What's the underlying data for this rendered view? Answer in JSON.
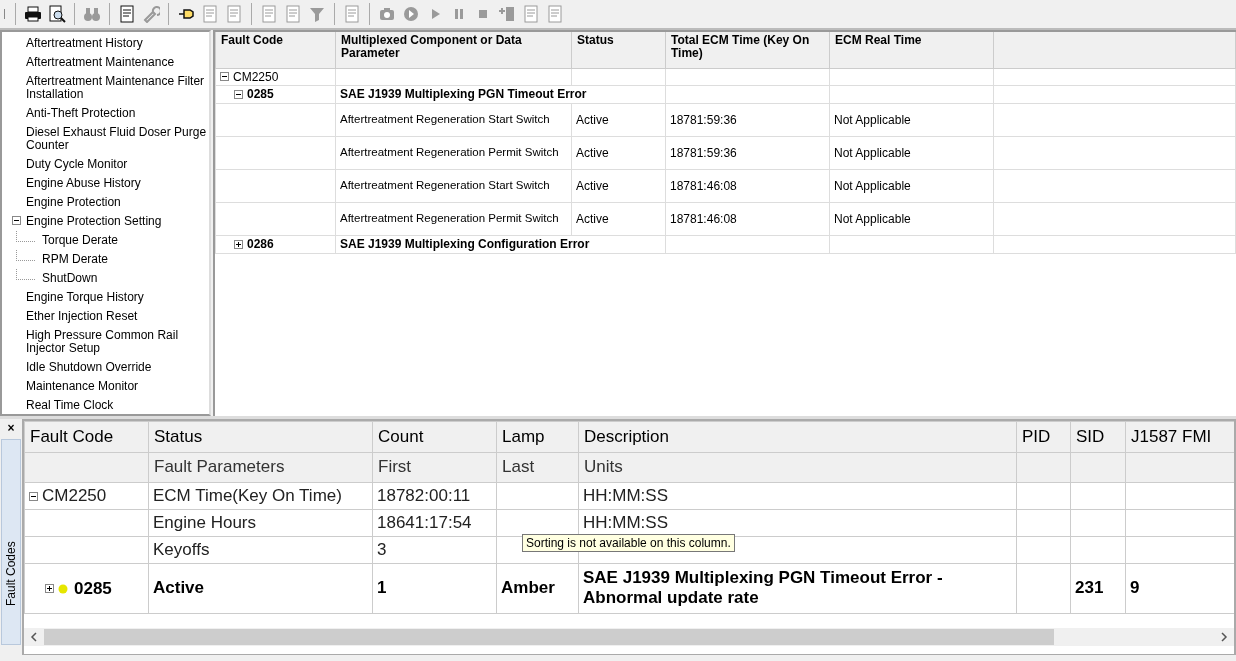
{
  "toolbar": {
    "groups": [
      [
        {
          "disabled": false
        },
        {
          "disabled": false
        }
      ],
      [
        {
          "disabled": true
        }
      ],
      [
        {
          "disabled": false
        },
        {
          "disabled": true
        }
      ],
      [
        {
          "disabled": false
        },
        {
          "disabled": true
        },
        {
          "disabled": true
        }
      ],
      [
        {
          "disabled": true
        },
        {
          "disabled": true
        },
        {
          "disabled": true
        }
      ],
      [
        {
          "disabled": true
        }
      ],
      [
        {
          "disabled": true
        },
        {
          "disabled": true
        },
        {
          "disabled": true
        },
        {
          "disabled": true
        },
        {
          "disabled": true
        },
        {
          "disabled": true
        },
        {
          "disabled": true
        },
        {
          "disabled": true
        }
      ]
    ]
  },
  "sidebar": {
    "items": [
      {
        "label": "Aftertreatment History"
      },
      {
        "label": "Aftertreatment Maintenance"
      },
      {
        "label": "Aftertreatment Maintenance Filter Installation"
      },
      {
        "label": "Anti-Theft Protection"
      },
      {
        "label": "Diesel Exhaust Fluid Doser Purge Counter"
      },
      {
        "label": "Duty Cycle Monitor"
      },
      {
        "label": "Engine Abuse History"
      },
      {
        "label": "Engine Protection"
      },
      {
        "label": "Engine Protection Setting",
        "expanded": true,
        "children": [
          {
            "label": "Torque Derate"
          },
          {
            "label": "RPM Derate"
          },
          {
            "label": "ShutDown"
          }
        ]
      },
      {
        "label": "Engine Torque History"
      },
      {
        "label": "Ether Injection Reset"
      },
      {
        "label": "High Pressure Common Rail Injector Setup"
      },
      {
        "label": "Idle Shutdown Override"
      },
      {
        "label": "Maintenance Monitor"
      },
      {
        "label": "Real Time Clock"
      }
    ]
  },
  "fault_table": {
    "columns": [
      "Fault Code",
      "Multiplexed Component or Data Parameter",
      "Status",
      "Total ECM Time (Key On Time)",
      "ECM Real Time"
    ],
    "rows": [
      {
        "code": "CM2250",
        "expanded": true,
        "children": [
          {
            "code": "0285",
            "title": "SAE J1939 Multiplexing PGN Timeout Error",
            "expanded": true,
            "children": [
              {
                "component": "Aftertreatment Regeneration Start Switch",
                "status": "Active",
                "total_time": "18781:59:36",
                "real_time": "Not Applicable"
              },
              {
                "component": "Aftertreatment Regeneration Permit Switch",
                "status": "Active",
                "total_time": "18781:59:36",
                "real_time": "Not Applicable"
              },
              {
                "component": "Aftertreatment Regeneration Start Switch",
                "status": "Active",
                "total_time": "18781:46:08",
                "real_time": "Not Applicable"
              },
              {
                "component": "Aftertreatment Regeneration Permit Switch",
                "status": "Active",
                "total_time": "18781:46:08",
                "real_time": "Not Applicable"
              }
            ]
          },
          {
            "code": "0286",
            "title": "SAE J1939 Multiplexing Configuration Error",
            "expanded": false
          }
        ]
      }
    ]
  },
  "fault_codes": {
    "close_glyph": "×",
    "tab": "Fault Codes",
    "columns": [
      "Fault Code",
      "Status",
      "Count",
      "Lamp",
      "Description",
      "PID",
      "SID",
      "J1587 FMI"
    ],
    "sub_header": {
      "status": "Fault Parameters",
      "count": "First",
      "lamp": "Last",
      "description": "Units"
    },
    "groups": [
      {
        "code": "CM2250",
        "expanded": true,
        "parameters": [
          {
            "name": "ECM Time(Key On Time)",
            "first": "18782:00:11",
            "units": "HH:MM:SS"
          },
          {
            "name": "Engine Hours",
            "first": "18641:17:54",
            "units": "HH:MM:SS"
          },
          {
            "name": "Keyoffs",
            "first": "3"
          }
        ],
        "faults": [
          {
            "code": "0285",
            "expanded": false,
            "color": "#e6e600",
            "status": "Active",
            "count": "1",
            "lamp": "Amber",
            "description": "SAE J1939 Multiplexing PGN Timeout Error - Abnormal update rate",
            "sid": "231",
            "fmi": "9"
          }
        ]
      }
    ],
    "tooltip": "Sorting is not available on this column."
  }
}
